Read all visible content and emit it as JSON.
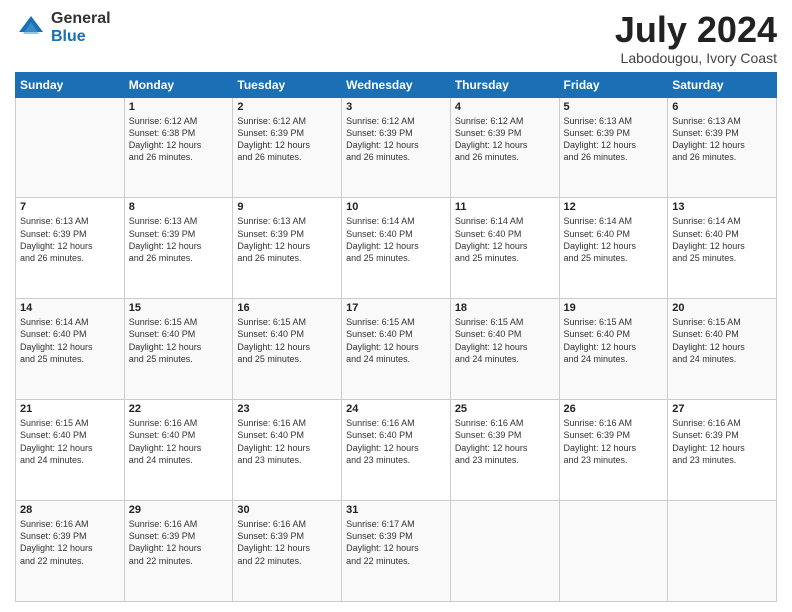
{
  "header": {
    "logo_general": "General",
    "logo_blue": "Blue",
    "month_title": "July 2024",
    "location": "Labodougou, Ivory Coast"
  },
  "days_of_week": [
    "Sunday",
    "Monday",
    "Tuesday",
    "Wednesday",
    "Thursday",
    "Friday",
    "Saturday"
  ],
  "weeks": [
    [
      {
        "day": "",
        "info": ""
      },
      {
        "day": "1",
        "info": "Sunrise: 6:12 AM\nSunset: 6:38 PM\nDaylight: 12 hours\nand 26 minutes."
      },
      {
        "day": "2",
        "info": "Sunrise: 6:12 AM\nSunset: 6:39 PM\nDaylight: 12 hours\nand 26 minutes."
      },
      {
        "day": "3",
        "info": "Sunrise: 6:12 AM\nSunset: 6:39 PM\nDaylight: 12 hours\nand 26 minutes."
      },
      {
        "day": "4",
        "info": "Sunrise: 6:12 AM\nSunset: 6:39 PM\nDaylight: 12 hours\nand 26 minutes."
      },
      {
        "day": "5",
        "info": "Sunrise: 6:13 AM\nSunset: 6:39 PM\nDaylight: 12 hours\nand 26 minutes."
      },
      {
        "day": "6",
        "info": "Sunrise: 6:13 AM\nSunset: 6:39 PM\nDaylight: 12 hours\nand 26 minutes."
      }
    ],
    [
      {
        "day": "7",
        "info": "Sunrise: 6:13 AM\nSunset: 6:39 PM\nDaylight: 12 hours\nand 26 minutes."
      },
      {
        "day": "8",
        "info": "Sunrise: 6:13 AM\nSunset: 6:39 PM\nDaylight: 12 hours\nand 26 minutes."
      },
      {
        "day": "9",
        "info": "Sunrise: 6:13 AM\nSunset: 6:39 PM\nDaylight: 12 hours\nand 26 minutes."
      },
      {
        "day": "10",
        "info": "Sunrise: 6:14 AM\nSunset: 6:40 PM\nDaylight: 12 hours\nand 25 minutes."
      },
      {
        "day": "11",
        "info": "Sunrise: 6:14 AM\nSunset: 6:40 PM\nDaylight: 12 hours\nand 25 minutes."
      },
      {
        "day": "12",
        "info": "Sunrise: 6:14 AM\nSunset: 6:40 PM\nDaylight: 12 hours\nand 25 minutes."
      },
      {
        "day": "13",
        "info": "Sunrise: 6:14 AM\nSunset: 6:40 PM\nDaylight: 12 hours\nand 25 minutes."
      }
    ],
    [
      {
        "day": "14",
        "info": "Sunrise: 6:14 AM\nSunset: 6:40 PM\nDaylight: 12 hours\nand 25 minutes."
      },
      {
        "day": "15",
        "info": "Sunrise: 6:15 AM\nSunset: 6:40 PM\nDaylight: 12 hours\nand 25 minutes."
      },
      {
        "day": "16",
        "info": "Sunrise: 6:15 AM\nSunset: 6:40 PM\nDaylight: 12 hours\nand 25 minutes."
      },
      {
        "day": "17",
        "info": "Sunrise: 6:15 AM\nSunset: 6:40 PM\nDaylight: 12 hours\nand 24 minutes."
      },
      {
        "day": "18",
        "info": "Sunrise: 6:15 AM\nSunset: 6:40 PM\nDaylight: 12 hours\nand 24 minutes."
      },
      {
        "day": "19",
        "info": "Sunrise: 6:15 AM\nSunset: 6:40 PM\nDaylight: 12 hours\nand 24 minutes."
      },
      {
        "day": "20",
        "info": "Sunrise: 6:15 AM\nSunset: 6:40 PM\nDaylight: 12 hours\nand 24 minutes."
      }
    ],
    [
      {
        "day": "21",
        "info": "Sunrise: 6:15 AM\nSunset: 6:40 PM\nDaylight: 12 hours\nand 24 minutes."
      },
      {
        "day": "22",
        "info": "Sunrise: 6:16 AM\nSunset: 6:40 PM\nDaylight: 12 hours\nand 24 minutes."
      },
      {
        "day": "23",
        "info": "Sunrise: 6:16 AM\nSunset: 6:40 PM\nDaylight: 12 hours\nand 23 minutes."
      },
      {
        "day": "24",
        "info": "Sunrise: 6:16 AM\nSunset: 6:40 PM\nDaylight: 12 hours\nand 23 minutes."
      },
      {
        "day": "25",
        "info": "Sunrise: 6:16 AM\nSunset: 6:39 PM\nDaylight: 12 hours\nand 23 minutes."
      },
      {
        "day": "26",
        "info": "Sunrise: 6:16 AM\nSunset: 6:39 PM\nDaylight: 12 hours\nand 23 minutes."
      },
      {
        "day": "27",
        "info": "Sunrise: 6:16 AM\nSunset: 6:39 PM\nDaylight: 12 hours\nand 23 minutes."
      }
    ],
    [
      {
        "day": "28",
        "info": "Sunrise: 6:16 AM\nSunset: 6:39 PM\nDaylight: 12 hours\nand 22 minutes."
      },
      {
        "day": "29",
        "info": "Sunrise: 6:16 AM\nSunset: 6:39 PM\nDaylight: 12 hours\nand 22 minutes."
      },
      {
        "day": "30",
        "info": "Sunrise: 6:16 AM\nSunset: 6:39 PM\nDaylight: 12 hours\nand 22 minutes."
      },
      {
        "day": "31",
        "info": "Sunrise: 6:17 AM\nSunset: 6:39 PM\nDaylight: 12 hours\nand 22 minutes."
      },
      {
        "day": "",
        "info": ""
      },
      {
        "day": "",
        "info": ""
      },
      {
        "day": "",
        "info": ""
      }
    ]
  ]
}
